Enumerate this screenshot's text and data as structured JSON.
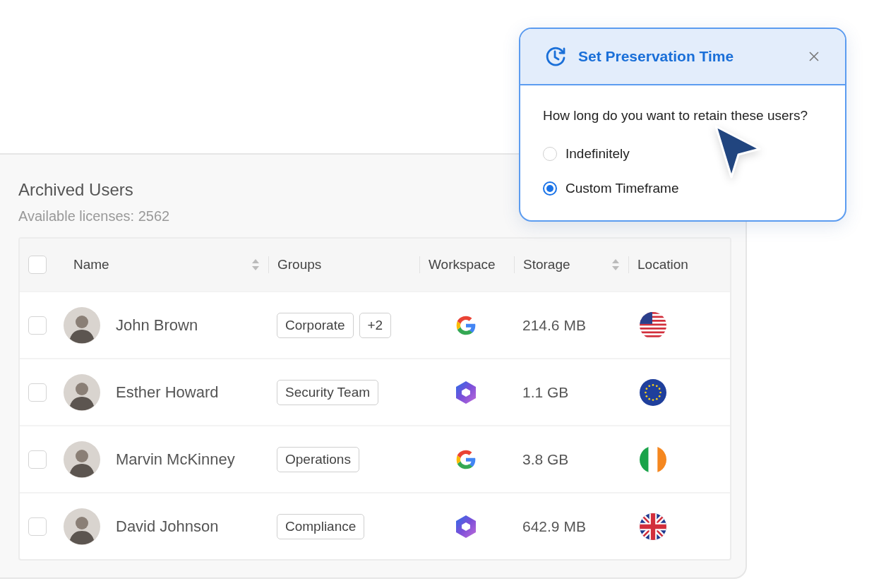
{
  "card": {
    "title": "Archived Users",
    "subtitle": "Available licenses: 2562"
  },
  "table": {
    "all_checked": false,
    "columns": [
      {
        "label": "Name",
        "sortable": true
      },
      {
        "label": "Groups",
        "sortable": false
      },
      {
        "label": "Workspace",
        "sortable": false
      },
      {
        "label": "Storage",
        "sortable": true
      },
      {
        "label": "Location",
        "sortable": false
      }
    ],
    "rows": [
      {
        "checked": false,
        "name": "John Brown",
        "groups": [
          "Corporate",
          "+2"
        ],
        "workspace": {
          "kind": "google"
        },
        "storage": "214.6 MB",
        "location": {
          "kind": "us"
        }
      },
      {
        "checked": false,
        "name": "Esther Howard",
        "groups": [
          "Security Team"
        ],
        "workspace": {
          "kind": "microsoft"
        },
        "storage": "1.1 GB",
        "location": {
          "kind": "eu"
        }
      },
      {
        "checked": false,
        "name": "Marvin McKinney",
        "groups": [
          "Operations"
        ],
        "workspace": {
          "kind": "google"
        },
        "storage": "3.8 GB",
        "location": {
          "kind": "ie"
        }
      },
      {
        "checked": false,
        "name": "David Johnson",
        "groups": [
          "Compliance"
        ],
        "workspace": {
          "kind": "microsoft"
        },
        "storage": "642.9 MB",
        "location": {
          "kind": "gb"
        }
      }
    ]
  },
  "dialog": {
    "title": "Set Preservation Time",
    "question": "How long do you want to retain these users?",
    "options": [
      {
        "label": "Indefinitely",
        "selected": false
      },
      {
        "label": "Custom Timeframe",
        "selected": true
      }
    ]
  }
}
